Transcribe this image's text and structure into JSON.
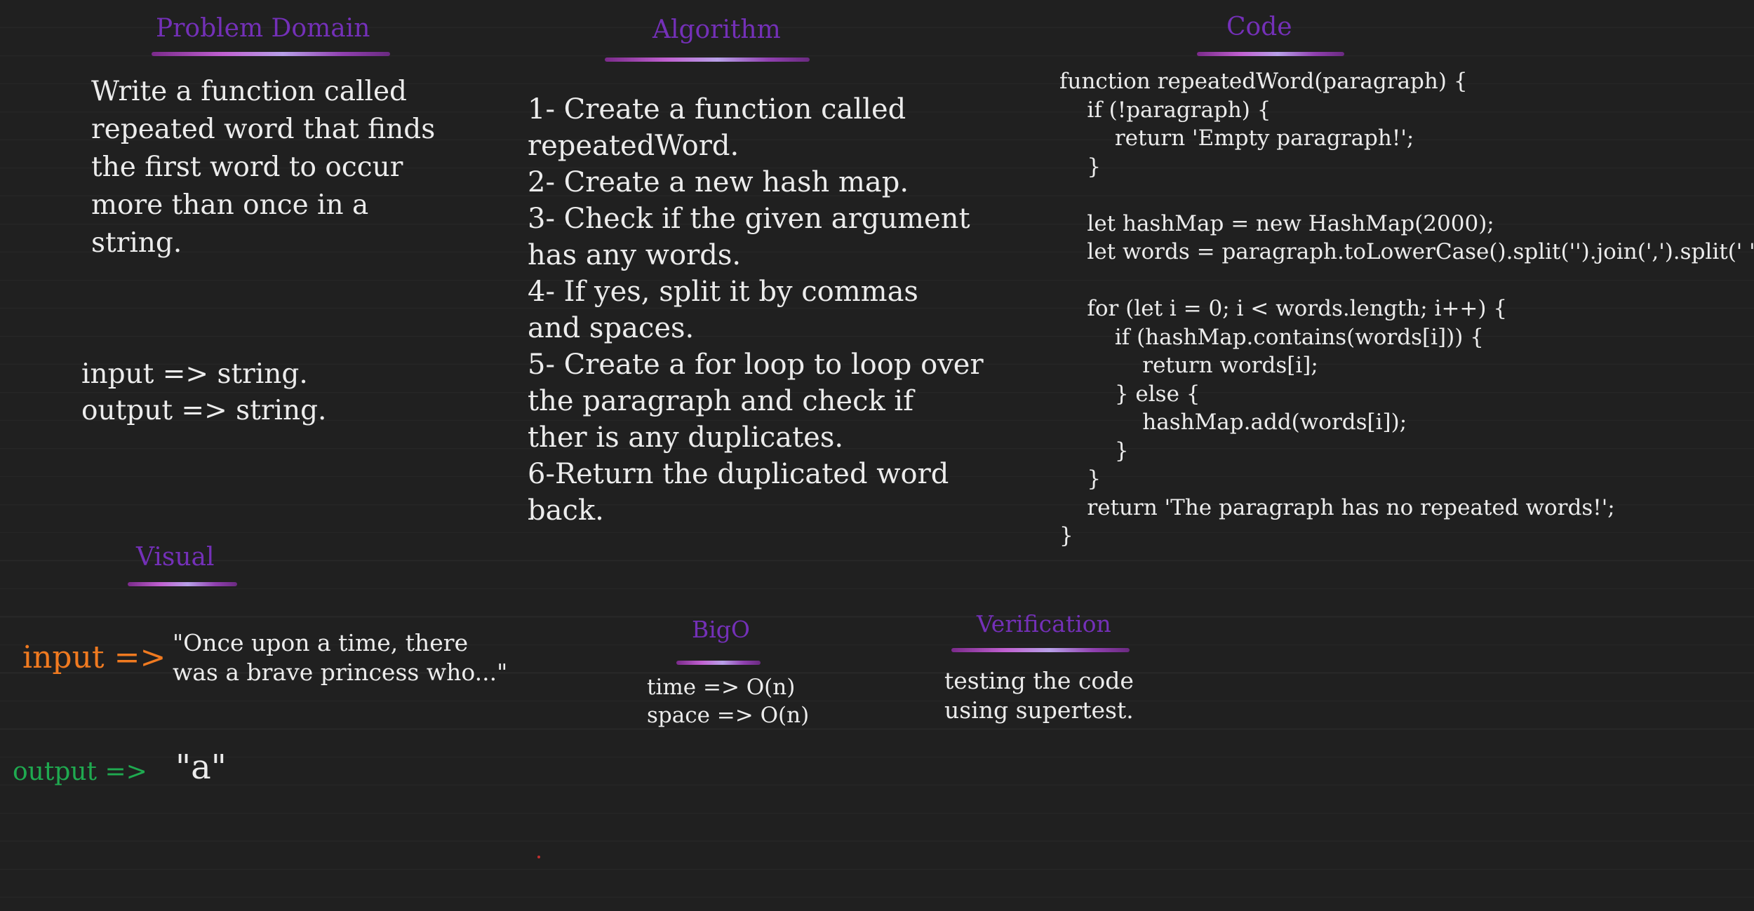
{
  "headings": {
    "problem": "Problem Domain",
    "algorithm": "Algorithm",
    "code": "Code",
    "visual": "Visual",
    "bigo": "BigO",
    "verification": "Verification"
  },
  "problem_text": "Write a function called\nrepeated word that finds\nthe first word to occur\nmore than once in a\nstring.",
  "io_text": "input => string.\noutput => string.",
  "algorithm_text": "1- Create a function called\nrepeatedWord.\n2- Create a new hash map.\n3- Check if the given argument\nhas any words.\n4- If yes, split it by commas\nand spaces.\n5- Create a for loop to loop over\nthe paragraph and check if\nther is any duplicates.\n6-Return the duplicated word\nback.",
  "code_text": "function repeatedWord(paragraph) {\n    if (!paragraph) {\n        return 'Empty paragraph!';\n    }\n\n    let hashMap = new HashMap(2000);\n    let words = paragraph.toLowerCase().split('').join(',').split(' ');\n\n    for (let i = 0; i < words.length; i++) {\n        if (hashMap.contains(words[i])) {\n            return words[i];\n        } else {\n            hashMap.add(words[i]);\n        }\n    }\n    return 'The paragraph has no repeated words!';\n}",
  "visual": {
    "input_label": "input =>",
    "input_text": "\"Once upon a time, there\nwas a brave princess who...\"",
    "output_label": "output =>",
    "output_text": "\"a\""
  },
  "bigo_text": "time => O(n)\nspace => O(n)",
  "verification_text": "testing the code\nusing supertest.",
  "colors": {
    "heading": "#7430b8",
    "input_label": "#f07a20",
    "output_label": "#1faa50",
    "background": "#202020"
  }
}
